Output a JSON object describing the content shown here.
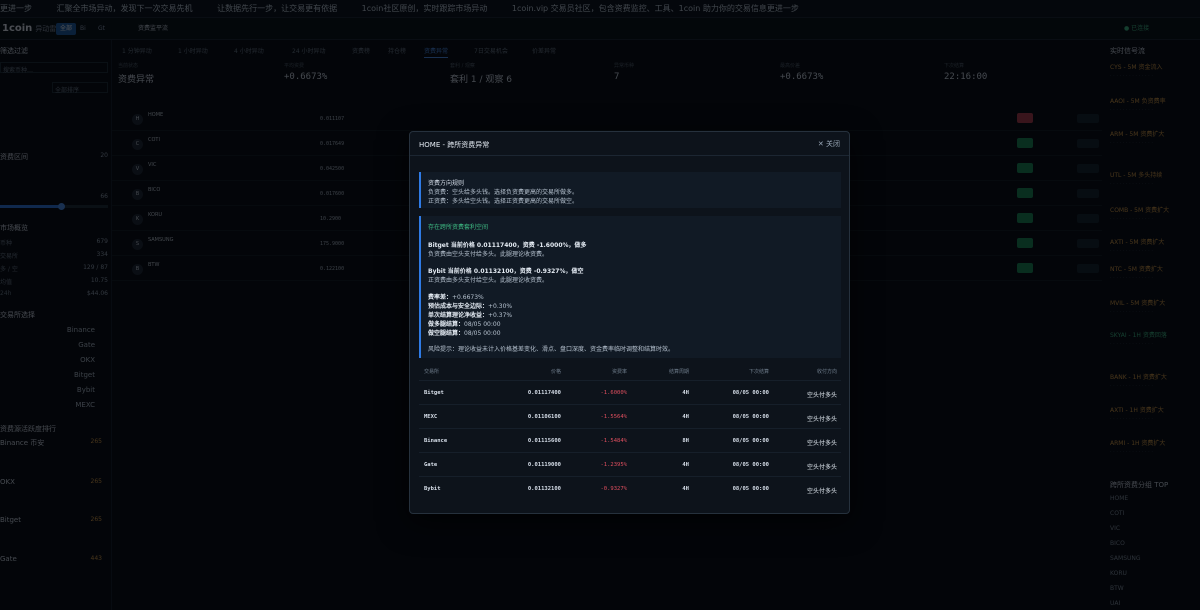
{
  "ticker": [
    "更进一步",
    "汇聚全市场异动，发现下一次交易先机",
    "让数据先行一步，让交易更有依据",
    "1coin社区原创，实时跟踪市场异动",
    "1coin.vip 交易员社区，包含资费监控、工具、1coin 助力你的交易信息更进一步"
  ],
  "topbar": {
    "logo": "1coin",
    "subtitle": "异动雷达",
    "pills": [
      "全部",
      "Bi",
      "Gt"
    ],
    "section": "资费监平流",
    "status": "● 已连接"
  },
  "left": {
    "title_filter": "筛选过滤",
    "search_placeholder": "搜索币种…",
    "select_sort": "全部排序",
    "title_range": "资费区间",
    "range_value": "20",
    "threshold_value": "66",
    "title_overview": "市场概览",
    "overview": [
      {
        "k": "币种",
        "v": "679"
      },
      {
        "k": "交易所",
        "v": "334"
      },
      {
        "k": "多 / 空",
        "v": "129 / 87"
      },
      {
        "k": "均值",
        "v": "10.75"
      },
      {
        "k": "24h",
        "v": "$44.06"
      }
    ],
    "title_exchanges": "交易所选择",
    "exchanges": [
      "Binance",
      "Gate",
      "OKX",
      "Bitget",
      "Bybit",
      "MEXC"
    ],
    "title_rank": "资费源活跃度排行",
    "rank": [
      {
        "name": "Binance 币安",
        "value": "265"
      },
      {
        "name": "OKX",
        "value": "265"
      },
      {
        "name": "Bitget",
        "value": "265"
      },
      {
        "name": "Gate",
        "value": "443"
      }
    ]
  },
  "tabs": [
    "1 分钟异动",
    "1 小时异动",
    "4 小时异动",
    "24 小时异动",
    "资费榜",
    "持仓榜",
    "资费异常",
    "7日交易机会",
    "价差异常"
  ],
  "stats": [
    {
      "k": "当前状态",
      "v": "资费异常"
    },
    {
      "k": "平均资费",
      "v": "+0.6673%"
    },
    {
      "k": "套利 / 观察",
      "v": "套利 1 / 观察 6"
    },
    {
      "k": "异常币种",
      "v": "7"
    },
    {
      "k": "最高价差",
      "v": "+0.6673%"
    },
    {
      "k": "下次结算",
      "v": "22:16:00"
    }
  ],
  "rows": [
    {
      "icon": "H",
      "sym": "HOME",
      "price": "0.011107",
      "tag": "-1.6000%"
    },
    {
      "icon": "C",
      "sym": "COTI",
      "price": "0.017649",
      "tag": ""
    },
    {
      "icon": "V",
      "sym": "VIC",
      "price": "0.042500",
      "tag": ""
    },
    {
      "icon": "B",
      "sym": "BICO",
      "price": "0.017600",
      "tag": ""
    },
    {
      "icon": "K",
      "sym": "KORU",
      "price": "10.2900",
      "tag": ""
    },
    {
      "icon": "S",
      "sym": "SAMSUNG",
      "price": "175.9000",
      "tag": ""
    },
    {
      "icon": "B",
      "sym": "BTW",
      "price": "0.122100",
      "tag": ""
    }
  ],
  "right": {
    "title_live": "实时信号流",
    "live": [
      "CYS - 5M 资金流入",
      "AAOI - 5M 负资费率",
      "ARM - 5M 资费扩大",
      "UTL - 5M 多头持续",
      "COMB - 5M 资费扩大",
      "AXTI - 5M 资费扩大",
      "NTC - 5M 资费扩大",
      "MVIL - 5M 资费扩大",
      "SKYAI - 1H 资费回落",
      "BANK - 1H 资费扩大",
      "AXTI - 1H 资费扩大",
      "ARMI - 1H 资费扩大"
    ],
    "title_top": "跨所资费分组 TOP",
    "top": [
      "HOME",
      "COTI",
      "VIC",
      "BICO",
      "SAMSUNG",
      "KORU",
      "BTW",
      "UAI"
    ]
  },
  "modal": {
    "title": "HOME - 跨所资费异常",
    "close_label": "✕ 关闭",
    "rule_title": "资费方向规则",
    "rule_neg": "负资费：空头给多头钱。选择负资费更高的交易所做多。",
    "rule_pos": "正资费：多头给空头钱。选择正资费更高的交易所做空。",
    "arb_title": "存在跨所资费套利空间",
    "bitget_head": "Bitget 当前价格 0.01117400，资费 -1.6000%，做多",
    "bitget_note": "负资费由空头支付给多头。此腿理论收资费。",
    "bybit_head": "Bybit 当前价格 0.01132100，资费 -0.9327%，做空",
    "bybit_note": "正资费由多头支付给空头。此腿理论收资费。",
    "spread_k": "费率差：",
    "spread_v": "+0.6673%",
    "cost_k": "预估成本与安全边际：",
    "cost_v": "+0.30%",
    "net_k": "单次结算理论净收益：",
    "net_v": "+0.37%",
    "long_k": "做多腿结算：",
    "long_v": "08/05 00:00",
    "short_k": "做空腿结算：",
    "short_v": "08/05 00:00",
    "risk": "风险提示：理论收益未计入价格基差变化、滑点、盘口深度、资金费率临时调整和结算时效。",
    "headers": [
      "交易所",
      "价格",
      "资费率",
      "结算周期",
      "下次结算",
      "收付方向"
    ],
    "rows": [
      {
        "ex": "Bitget",
        "price": "0.01117400",
        "rate": "-1.6000%",
        "cycle": "4H",
        "next": "08/05 00:00",
        "dir": "空头付多头"
      },
      {
        "ex": "MEXC",
        "price": "0.01106100",
        "rate": "-1.5564%",
        "cycle": "4H",
        "next": "08/05 00:00",
        "dir": "空头付多头"
      },
      {
        "ex": "Binance",
        "price": "0.01115600",
        "rate": "-1.5484%",
        "cycle": "8H",
        "next": "08/05 00:00",
        "dir": "空头付多头"
      },
      {
        "ex": "Gate",
        "price": "0.01119000",
        "rate": "-1.2395%",
        "cycle": "4H",
        "next": "08/05 00:00",
        "dir": "空头付多头"
      },
      {
        "ex": "Bybit",
        "price": "0.01132100",
        "rate": "-0.9327%",
        "cycle": "4H",
        "next": "08/05 00:00",
        "dir": "空头付多头"
      }
    ]
  }
}
